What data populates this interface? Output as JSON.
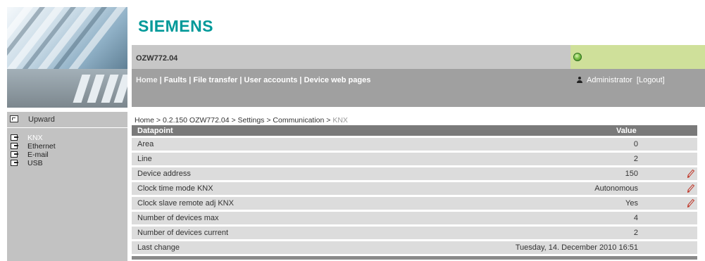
{
  "brand": {
    "logo_text": "SIEMENS",
    "color": "#009999"
  },
  "header": {
    "device_name": "OZW772.04",
    "status_color": "#cfe09a",
    "nav": {
      "home": "Home",
      "sep": " | ",
      "items": [
        "Faults",
        "File transfer",
        "User accounts",
        "Device web pages"
      ]
    },
    "user": {
      "name": "Administrator",
      "logout": "[Logout]"
    }
  },
  "sidebar": {
    "upward": "Upward",
    "items": [
      {
        "label": "KNX",
        "active": true
      },
      {
        "label": "Ethernet",
        "active": false
      },
      {
        "label": "E-mail",
        "active": false
      },
      {
        "label": "USB",
        "active": false
      }
    ]
  },
  "breadcrumb": {
    "path": "Home > 0.2.150 OZW772.04 > Settings > Communication > ",
    "current": "KNX"
  },
  "table": {
    "col_datapoint": "Datapoint",
    "col_value": "Value",
    "rows": [
      {
        "name": "Area",
        "value": "0",
        "editable": false
      },
      {
        "name": "Line",
        "value": "2",
        "editable": false
      },
      {
        "name": "Device address",
        "value": "150",
        "editable": true
      },
      {
        "name": "Clock time mode KNX",
        "value": "Autonomous",
        "editable": true
      },
      {
        "name": "Clock slave remote adj KNX",
        "value": "Yes",
        "editable": true
      },
      {
        "name": "Number of devices max",
        "value": "4",
        "editable": false
      },
      {
        "name": "Number of devices current",
        "value": "2",
        "editable": false
      },
      {
        "name": "Last change",
        "value": "Tuesday, 14. December 2010 16:51",
        "editable": false
      }
    ]
  },
  "icons": {
    "edit": "pencil-icon",
    "status": "status-ok-icon",
    "user": "user-icon",
    "upward": "upward-icon",
    "nav_item": "nav-arrow-icon"
  }
}
